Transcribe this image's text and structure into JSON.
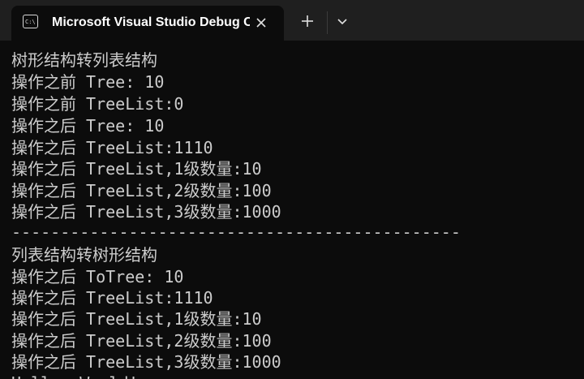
{
  "titlebar": {
    "tab_title": "Microsoft Visual Studio Debug Console"
  },
  "console": {
    "lines": [
      "树形结构转列表结构",
      "操作之前 Tree: 10",
      "操作之前 TreeList:0",
      "操作之后 Tree: 10",
      "操作之后 TreeList:1110",
      "操作之后 TreeList,1级数量:10",
      "操作之后 TreeList,2级数量:100",
      "操作之后 TreeList,3级数量:1000",
      "----------------------------------------------",
      "列表结构转树形结构",
      "操作之后 ToTree: 10",
      "操作之后 TreeList:1110",
      "操作之后 TreeList,1级数量:10",
      "操作之后 TreeList,2级数量:100",
      "操作之后 TreeList,3级数量:1000",
      "Hello, World!"
    ]
  },
  "icons": {
    "tab": "console-app-icon",
    "close": "close-icon",
    "new_tab": "plus-icon",
    "dropdown": "chevron-down-icon"
  },
  "colors": {
    "background": "#0c0c0c",
    "titlebar": "#1f1f1f",
    "text": "#cccccc"
  }
}
